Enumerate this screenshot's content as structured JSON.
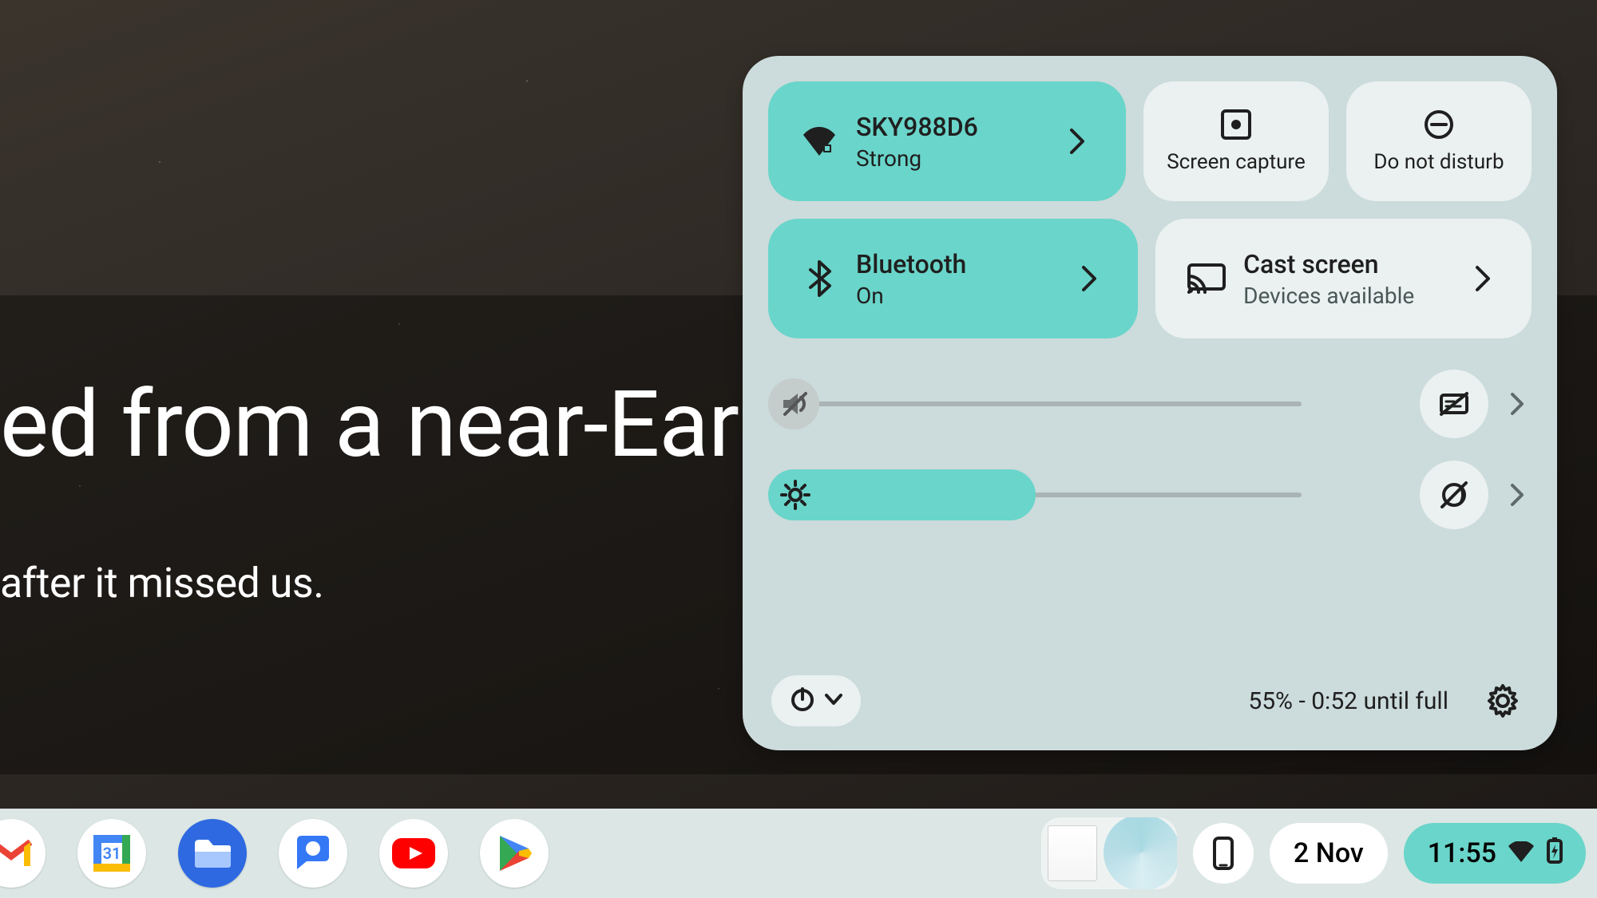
{
  "wallpaper": {
    "headline": "ed from a near-Ear",
    "subhead": "after it missed us."
  },
  "panel": {
    "wifi": {
      "ssid": "SKY988D6",
      "signal": "Strong",
      "active": true
    },
    "screen_capture": {
      "label": "Screen capture"
    },
    "dnd": {
      "label": "Do not disturb"
    },
    "bluetooth": {
      "title": "Bluetooth",
      "state": "On",
      "active": true
    },
    "cast": {
      "title": "Cast screen",
      "sub": "Devices available"
    },
    "volume": {
      "value": 0,
      "muted": true
    },
    "brightness": {
      "value": 48
    },
    "battery_text": "55% - 0:52 until full"
  },
  "shelf": {
    "date": "2 Nov",
    "time": "11:55"
  }
}
